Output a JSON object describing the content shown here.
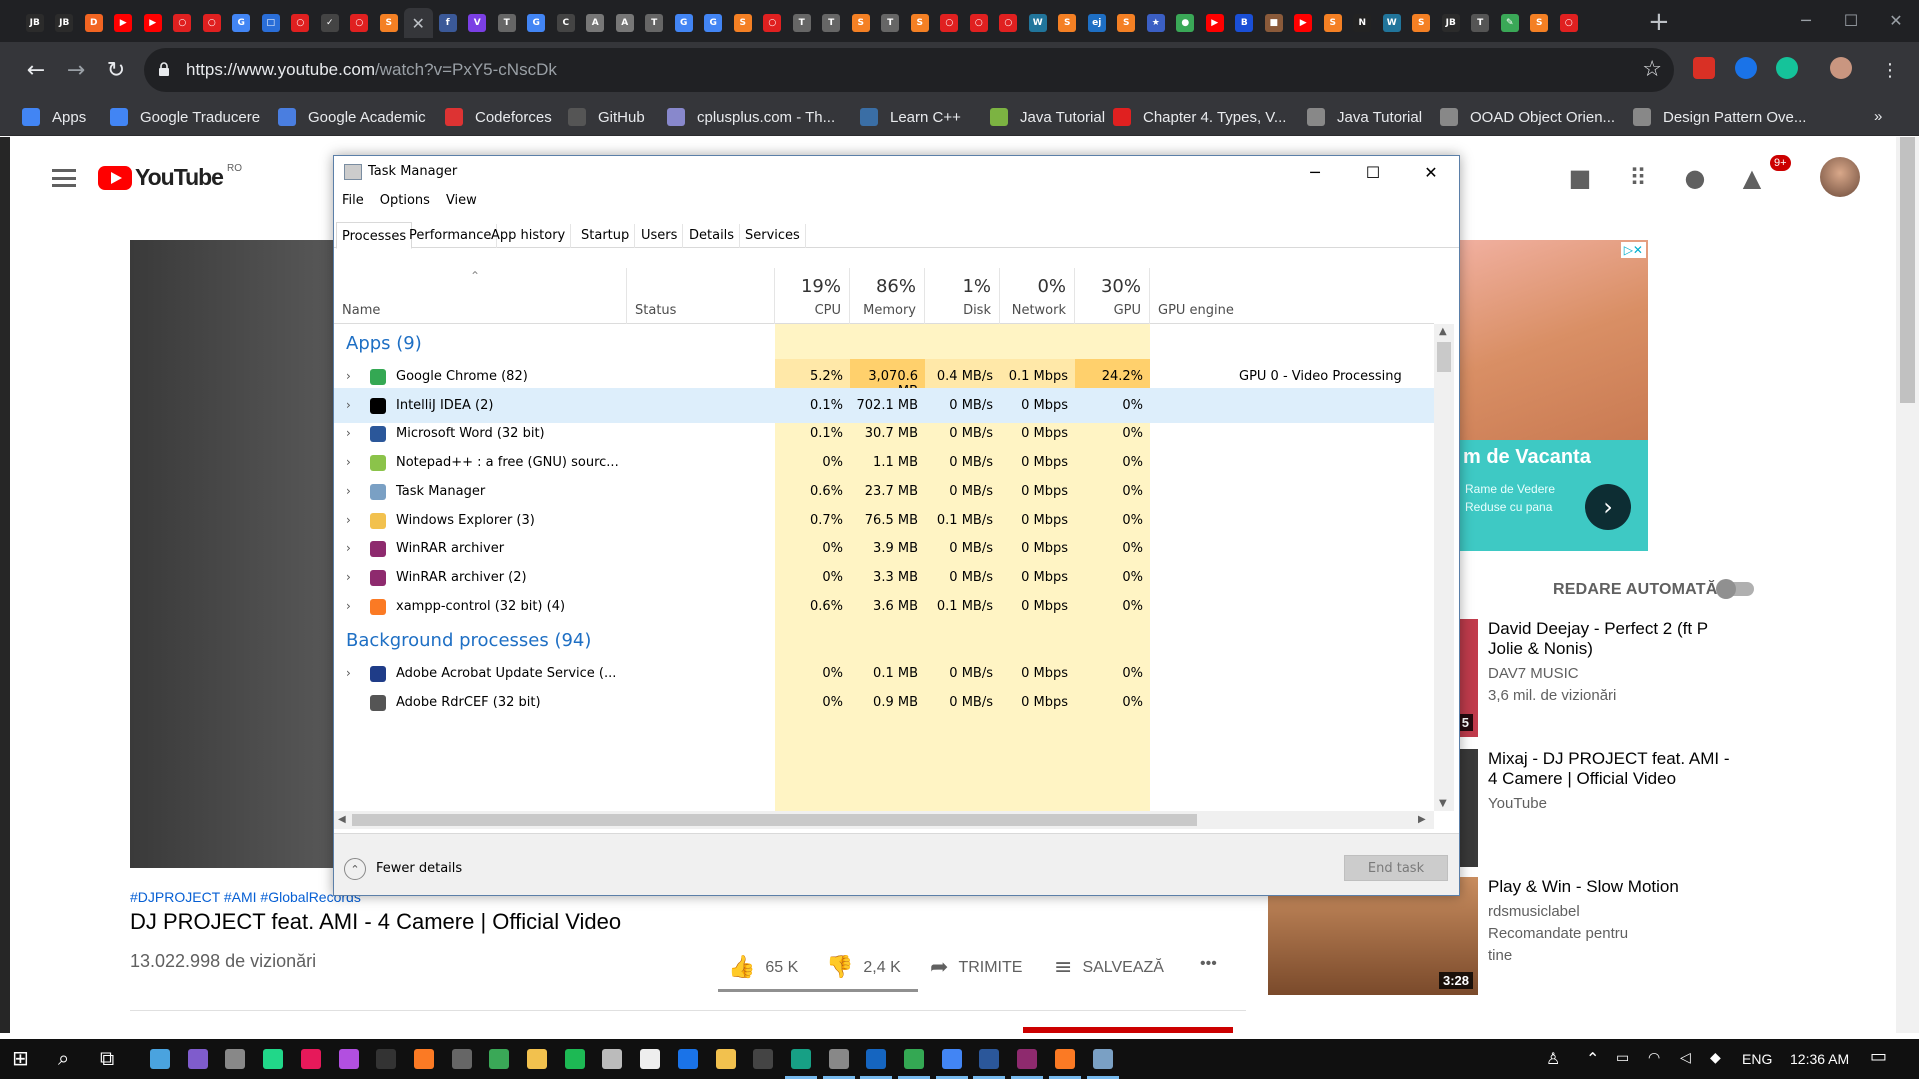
{
  "browser": {
    "tab_favicons": [
      {
        "text": "JB",
        "color": "#2b2b2b"
      },
      {
        "text": "JB",
        "color": "#2b2b2b"
      },
      {
        "text": "D",
        "color": "#f26522"
      },
      {
        "text": "▶",
        "color": "#ff0000"
      },
      {
        "text": "▶",
        "color": "#ff0000"
      },
      {
        "text": "○",
        "color": "#e02020"
      },
      {
        "text": "○",
        "color": "#e02020"
      },
      {
        "text": "G",
        "color": "#4285f4"
      },
      {
        "text": "□",
        "color": "#2a6ed8"
      },
      {
        "text": "○",
        "color": "#e02020"
      },
      {
        "text": "✓",
        "color": "#444"
      },
      {
        "text": "○",
        "color": "#e02020"
      },
      {
        "text": "S",
        "color": "#f48024"
      }
    ],
    "tab_favicons_right": [
      {
        "text": "f",
        "color": "#3b5998"
      },
      {
        "text": "V",
        "color": "#7b3fe4"
      },
      {
        "text": "T",
        "color": "#666"
      },
      {
        "text": "G",
        "color": "#4285f4"
      },
      {
        "text": "C",
        "color": "#444"
      },
      {
        "text": "A",
        "color": "#777"
      },
      {
        "text": "A",
        "color": "#777"
      },
      {
        "text": "T",
        "color": "#666"
      },
      {
        "text": "G",
        "color": "#4285f4"
      },
      {
        "text": "G",
        "color": "#4285f4"
      },
      {
        "text": "S",
        "color": "#f48024"
      },
      {
        "text": "○",
        "color": "#e02020"
      },
      {
        "text": "T",
        "color": "#666"
      },
      {
        "text": "T",
        "color": "#666"
      },
      {
        "text": "S",
        "color": "#f48024"
      },
      {
        "text": "T",
        "color": "#666"
      },
      {
        "text": "S",
        "color": "#f48024"
      },
      {
        "text": "○",
        "color": "#e02020"
      },
      {
        "text": "○",
        "color": "#e02020"
      },
      {
        "text": "○",
        "color": "#e02020"
      },
      {
        "text": "W",
        "color": "#21759b"
      },
      {
        "text": "S",
        "color": "#f48024"
      },
      {
        "text": "ej",
        "color": "#1e6fc4"
      },
      {
        "text": "S",
        "color": "#f48024"
      },
      {
        "text": "★",
        "color": "#3b5fc4"
      },
      {
        "text": "●",
        "color": "#3aa857"
      },
      {
        "text": "▶",
        "color": "#ff0000"
      },
      {
        "text": "B",
        "color": "#1a4fd6"
      },
      {
        "text": "■",
        "color": "#8a5a3a"
      },
      {
        "text": "▶",
        "color": "#ff0000"
      },
      {
        "text": "S",
        "color": "#f48024"
      },
      {
        "text": "N",
        "color": "#222"
      },
      {
        "text": "W",
        "color": "#21759b"
      },
      {
        "text": "S",
        "color": "#f48024"
      },
      {
        "text": "JB",
        "color": "#2b2b2b"
      },
      {
        "text": "T",
        "color": "#555"
      },
      {
        "text": "✎",
        "color": "#3aa857"
      },
      {
        "text": "S",
        "color": "#f48024"
      },
      {
        "text": "○",
        "color": "#e02020"
      }
    ],
    "active_tab_close": "✕",
    "new_tab": "+",
    "url_host": "https://www.youtube.com",
    "url_path": "/watch?v=PxY5-cNscDk",
    "bookmarks": [
      {
        "label": "Apps",
        "color": "#4285f4"
      },
      {
        "label": "Google Traducere",
        "color": "#4285f4"
      },
      {
        "label": "Google Academic",
        "color": "#4a7ee0"
      },
      {
        "label": "Codeforces",
        "color": "#d33"
      },
      {
        "label": "GitHub",
        "color": "#555"
      },
      {
        "label": "cplusplus.com - Th...",
        "color": "#8888cc"
      },
      {
        "label": "Learn C++",
        "color": "#3a6ea5"
      },
      {
        "label": "Java Tutorial",
        "color": "#7cb342"
      },
      {
        "label": "Chapter 4. Types, V...",
        "color": "#e02020"
      },
      {
        "label": "Java Tutorial",
        "color": "#888"
      },
      {
        "label": "OOAD Object Orien...",
        "color": "#888"
      },
      {
        "label": "Design Pattern Ove...",
        "color": "#888"
      }
    ],
    "bookmarks_more": "»"
  },
  "youtube": {
    "logo_word": "YouTube",
    "region": "RO",
    "notifications": "9+",
    "tags": "#DJPROJECT #AMI #GlobalRecords",
    "video_title": "DJ PROJECT feat. AMI - 4 Camere | Official Video",
    "views": "13.022.998 de vizionări",
    "likes": "65 K",
    "dislikes": "2,4 K",
    "share": "TRIMITE",
    "save": "SALVEAZĂ",
    "more": "•••",
    "ad_title": "m de Vacanta",
    "ad_sub": "Rame de Vedere Reduse cu pana",
    "autoplay_label": "REDARE AUTOMATĂ",
    "recommendations": [
      {
        "title": "David Deejay - Perfect 2 (ft P Jolie & Nonis)",
        "channel": "DAV7 MUSIC",
        "meta": "3,6 mil. de vizionări",
        "duration": "5"
      },
      {
        "title": "Mixaj - DJ PROJECT feat. AMI - 4 Camere | Official Video",
        "channel": "YouTube",
        "meta": "",
        "duration": ""
      },
      {
        "title": "Play & Win - Slow Motion",
        "channel": "rdsmusiclabel",
        "meta": "Recomandate pentru tine",
        "duration": "3:28"
      }
    ]
  },
  "task_manager": {
    "title": "Task Manager",
    "menu": [
      "File",
      "Options",
      "View"
    ],
    "tabs": [
      "Processes",
      "Performance",
      "App history",
      "Startup",
      "Users",
      "Details",
      "Services"
    ],
    "columns": {
      "name": "Name",
      "status": "Status",
      "cpu": {
        "pct": "19%",
        "label": "CPU"
      },
      "memory": {
        "pct": "86%",
        "label": "Memory"
      },
      "disk": {
        "pct": "1%",
        "label": "Disk"
      },
      "network": {
        "pct": "0%",
        "label": "Network"
      },
      "gpu": {
        "pct": "30%",
        "label": "GPU"
      },
      "gpu_engine": "GPU engine"
    },
    "groups": {
      "apps": "Apps (9)",
      "background": "Background processes (94)"
    },
    "apps": [
      {
        "name": "Google Chrome (82)",
        "cpu": "5.2%",
        "mem": "3,070.6 MB",
        "disk": "0.4 MB/s",
        "net": "0.1 Mbps",
        "gpu": "24.2%",
        "engine": "GPU 0 - Video Processing",
        "icon_color": "#34a853"
      },
      {
        "name": "IntelliJ IDEA (2)",
        "cpu": "0.1%",
        "mem": "702.1 MB",
        "disk": "0 MB/s",
        "net": "0 Mbps",
        "gpu": "0%",
        "engine": "",
        "icon_color": "#000000"
      },
      {
        "name": "Microsoft Word (32 bit)",
        "cpu": "0.1%",
        "mem": "30.7 MB",
        "disk": "0 MB/s",
        "net": "0 Mbps",
        "gpu": "0%",
        "engine": "",
        "icon_color": "#2b579a"
      },
      {
        "name": "Notepad++ : a free (GNU) sourc...",
        "cpu": "0%",
        "mem": "1.1 MB",
        "disk": "0 MB/s",
        "net": "0 Mbps",
        "gpu": "0%",
        "engine": "",
        "icon_color": "#8bc34a"
      },
      {
        "name": "Task Manager",
        "cpu": "0.6%",
        "mem": "23.7 MB",
        "disk": "0 MB/s",
        "net": "0 Mbps",
        "gpu": "0%",
        "engine": "",
        "icon_color": "#7aa0c4"
      },
      {
        "name": "Windows Explorer (3)",
        "cpu": "0.7%",
        "mem": "76.5 MB",
        "disk": "0.1 MB/s",
        "net": "0 Mbps",
        "gpu": "0%",
        "engine": "",
        "icon_color": "#f2c14e"
      },
      {
        "name": "WinRAR archiver",
        "cpu": "0%",
        "mem": "3.9 MB",
        "disk": "0 MB/s",
        "net": "0 Mbps",
        "gpu": "0%",
        "engine": "",
        "icon_color": "#8e2a6e"
      },
      {
        "name": "WinRAR archiver (2)",
        "cpu": "0%",
        "mem": "3.3 MB",
        "disk": "0 MB/s",
        "net": "0 Mbps",
        "gpu": "0%",
        "engine": "",
        "icon_color": "#8e2a6e"
      },
      {
        "name": "xampp-control (32 bit) (4)",
        "cpu": "0.6%",
        "mem": "3.6 MB",
        "disk": "0.1 MB/s",
        "net": "0 Mbps",
        "gpu": "0%",
        "engine": "",
        "icon_color": "#fb7a24"
      }
    ],
    "background": [
      {
        "name": "Adobe Acrobat Update Service (...",
        "cpu": "0%",
        "mem": "0.1 MB",
        "disk": "0 MB/s",
        "net": "0 Mbps",
        "gpu": "0%",
        "engine": "",
        "icon_color": "#1f3c88"
      },
      {
        "name": "Adobe RdrCEF (32 bit)",
        "cpu": "0%",
        "mem": "0.9 MB",
        "disk": "0 MB/s",
        "net": "0 Mbps",
        "gpu": "0%",
        "engine": "",
        "icon_color": "#555555"
      }
    ],
    "fewer_details": "Fewer details",
    "end_task": "End task"
  },
  "taskbar": {
    "language": "ENG",
    "time": "12:36 AM"
  }
}
